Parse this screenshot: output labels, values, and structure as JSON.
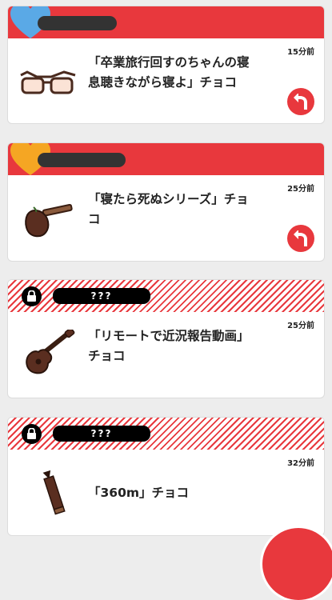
{
  "colors": {
    "accent": "#e8383d",
    "heart_blue": "#5aa9e6",
    "heart_orange": "#f5a623"
  },
  "cards": [
    {
      "time": "15分前",
      "title": "「卒業旅行回すのちゃんの寝息聴きながら寝よ」チョコ",
      "icon": "glasses-icon",
      "heart": "blue-heart-icon",
      "locked": false
    },
    {
      "time": "25分前",
      "title": "「寝たら死ぬシリーズ」チョコ",
      "icon": "guitar-icon",
      "heart": "orange-heart-icon",
      "locked": false
    },
    {
      "time": "25分前",
      "title": "「リモートで近況報告動画」チョコ",
      "icon": "ukulele-icon",
      "locked": true,
      "locked_name": "???"
    },
    {
      "time": "32分前",
      "title": "「360m」チョコ",
      "icon": "pencil-icon",
      "locked": true,
      "locked_name": "???"
    }
  ]
}
